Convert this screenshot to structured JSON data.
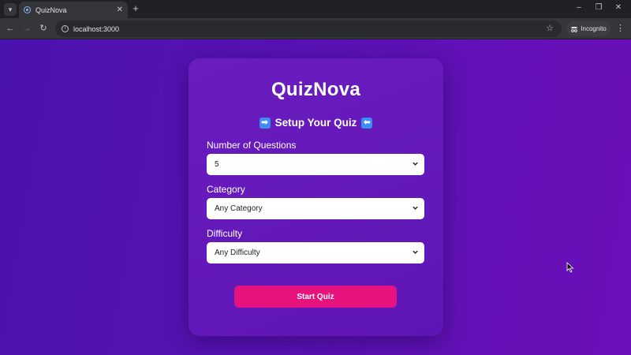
{
  "browser": {
    "tab_title": "QuizNova",
    "url": "localhost:3000",
    "incognito_label": "Incognito"
  },
  "app": {
    "title": "QuizNova",
    "subtitle": "Setup Your Quiz",
    "fields": [
      {
        "label": "Number of Questions",
        "value": "5"
      },
      {
        "label": "Category",
        "value": "Any Category"
      },
      {
        "label": "Difficulty",
        "value": "Any Difficulty"
      }
    ],
    "start_button": "Start Quiz"
  },
  "colors": {
    "accent_button": "#e8127f",
    "background": "#5a12b6",
    "card": "#6a1dbf"
  },
  "icons": [
    "tab-menu-icon",
    "favicon-icon",
    "close-icon",
    "new-tab-icon",
    "back-icon",
    "forward-icon",
    "reload-icon",
    "info-icon",
    "star-icon",
    "incognito-icon",
    "kebab-icon",
    "arrow-right-icon",
    "arrow-left-icon",
    "chevron-down-icon"
  ]
}
